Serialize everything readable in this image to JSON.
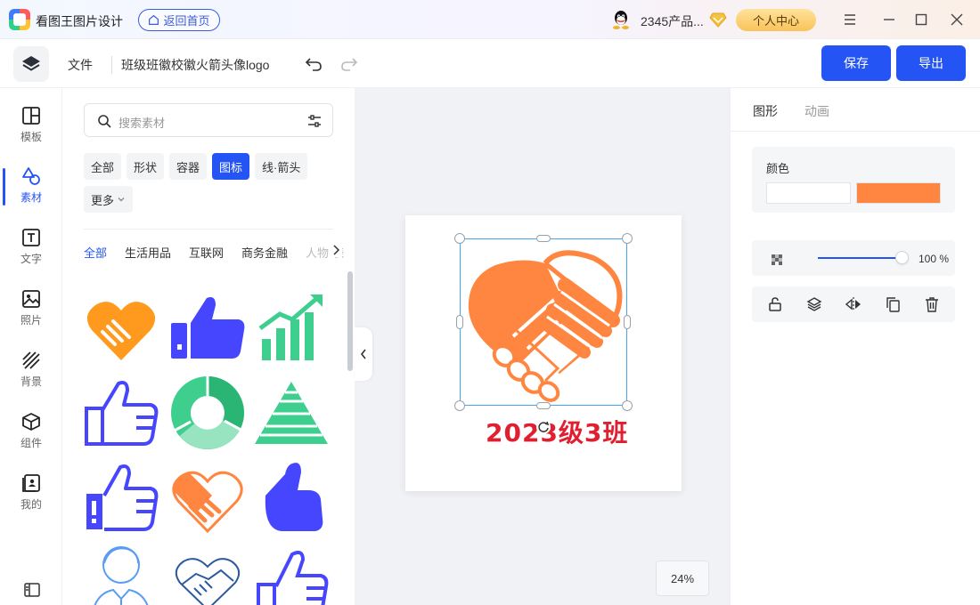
{
  "app": {
    "name": "看图王图片设计",
    "home_button": "返回首页",
    "user_name": "2345产品...",
    "personal_center": "个人中心"
  },
  "toolbar": {
    "file_menu": "文件",
    "doc_title": "班级班徽校徽火箭头像logo",
    "save_label": "保存",
    "export_label": "导出"
  },
  "leftnav": {
    "items": [
      {
        "label": "模板",
        "icon": "template-icon"
      },
      {
        "label": "素材",
        "icon": "shapes-icon",
        "active": true
      },
      {
        "label": "文字",
        "icon": "text-icon"
      },
      {
        "label": "照片",
        "icon": "photo-icon"
      },
      {
        "label": "背景",
        "icon": "background-icon"
      },
      {
        "label": "组件",
        "icon": "cube-icon"
      },
      {
        "label": "我的",
        "icon": "my-icon"
      }
    ]
  },
  "panel": {
    "search_placeholder": "搜索素材",
    "categories": [
      "全部",
      "形状",
      "容器",
      "图标",
      "线·箭头",
      "更多"
    ],
    "active_category": "图标",
    "subtabs": [
      "全部",
      "生活用品",
      "互联网",
      "商务金融",
      "人物·表"
    ],
    "active_subtab": "全部",
    "icons": [
      "handshake-heart-orange",
      "thumbs-up-blue",
      "growth-chart-green",
      "thumbs-up-outline",
      "donut-chart-green",
      "pyramid-green",
      "thumbs-up-blue-outline",
      "handshake-heart-orange-outline",
      "thumbs-up-solid-blue",
      "businessman-outline",
      "handshake-outline",
      "thumbs-up-outline-blue"
    ]
  },
  "canvas": {
    "logo_text": "2023级3班",
    "zoom": "24%"
  },
  "rpanel": {
    "tab_shape": "图形",
    "tab_animation": "动画",
    "color_label": "颜色",
    "colors": [
      "#ffffff",
      "#ff8640"
    ],
    "opacity_value": "100 %",
    "opacity_fraction": 1.0
  },
  "colors": {
    "accent": "#2554f5",
    "orange": "#ff8640",
    "green": "#3ecf8e",
    "icon_blue": "#4646ff",
    "logo_red": "#e02031"
  }
}
